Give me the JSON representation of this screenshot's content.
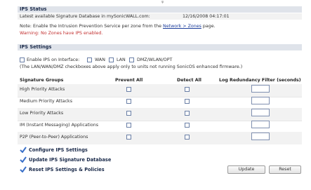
{
  "top_mark": "ψ",
  "ips_status": {
    "title": "IPS Status",
    "db_label": "Latest available Signature Database in mySonicWALL.com:",
    "db_timestamp": "12/16/2008 04:17:01",
    "note_prefix": "Note: Enable the Intrusion Prevention Service per zone from the ",
    "note_link": "Network > Zones",
    "note_suffix": " page.",
    "warning": "Warning: No Zones have IPS enabled."
  },
  "ips_settings": {
    "title": "IPS Settings",
    "enable_label": "Enable IPS on Interface:",
    "interfaces": [
      "WAN",
      "LAN",
      "DMZ/WLAN/OPT"
    ],
    "interfaces_note": "(The LAN/WAN/DMZ checkboxes above apply only to units not running SonicOS enhanced firmware.)",
    "columns": [
      "Signature Groups",
      "Prevent All",
      "Detect All",
      "Log Redundancy Filter (seconds)"
    ],
    "rows": [
      {
        "group": "High Priority Attacks"
      },
      {
        "group": "Medium Priority Attacks"
      },
      {
        "group": "Low Priority Attacks"
      },
      {
        "group": "IM (Instant Messaging) Applications"
      },
      {
        "group": "P2P (Peer-to-Peer) Applications"
      }
    ]
  },
  "actions": [
    {
      "label": "Configure IPS Settings"
    },
    {
      "label": "Update IPS Signature Database"
    },
    {
      "label": "Reset IPS Settings & Policies"
    }
  ],
  "buttons": {
    "update": "Update",
    "reset": "Reset"
  },
  "colors": {
    "header_bg": "#dfe3ea",
    "link": "#1a3c9a",
    "warning": "#c23030",
    "check": "#3a70c8"
  }
}
